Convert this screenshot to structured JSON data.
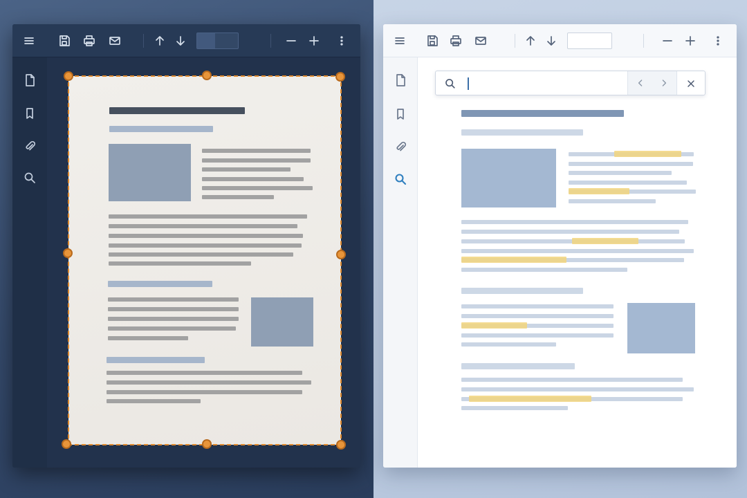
{
  "dark_viewer": {
    "toolbar": {
      "menu": "menu-icon",
      "save": "save-icon",
      "print": "print-icon",
      "email": "mail-icon",
      "prev_page": "arrow-up-icon",
      "next_page": "arrow-down-icon",
      "page_value": "",
      "zoom_out": "minus-icon",
      "zoom_in": "plus-icon",
      "more": "more-vertical-icon"
    },
    "sidebar": [
      "page-icon",
      "bookmark-icon",
      "attachment-icon",
      "search-icon"
    ],
    "crop_color": "#e08a2e"
  },
  "light_viewer": {
    "toolbar": {
      "menu": "menu-icon",
      "save": "save-icon",
      "print": "print-icon",
      "email": "mail-icon",
      "prev_page": "arrow-up-icon",
      "next_page": "arrow-down-icon",
      "page_value": "",
      "zoom_out": "minus-icon",
      "zoom_in": "plus-icon",
      "more": "more-vertical-icon"
    },
    "sidebar": [
      "page-icon",
      "bookmark-icon",
      "attachment-icon",
      "search-icon"
    ],
    "active_sidebar": "search-icon",
    "search": {
      "value": "",
      "placeholder": "",
      "prev": "chevron-left-icon",
      "next": "chevron-right-icon",
      "close": "close-icon"
    },
    "accent_color": "#2f7fbf",
    "highlight_color": "#f2d57e"
  }
}
